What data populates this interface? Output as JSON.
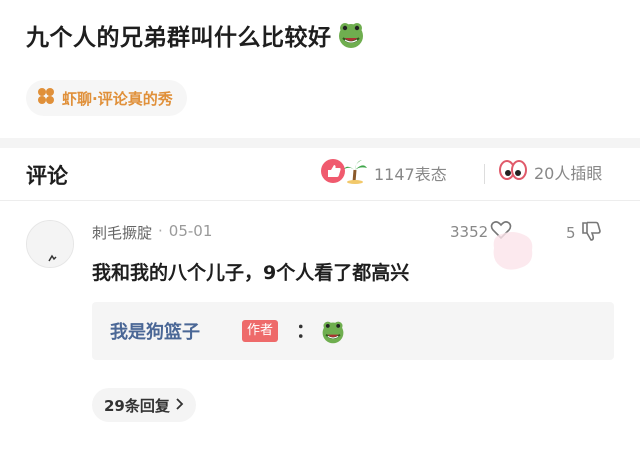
{
  "post": {
    "title": "九个人的兄弟群叫什么比较好",
    "title_emoji_icon": "green-frog-face-emoji",
    "topic_tag": "虾聊·评论真的秀",
    "topic_icon": "four-dots-flower-icon",
    "accent_color": "#e0903a"
  },
  "comments_header": {
    "title": "评论",
    "reactions_count": "1147表态",
    "eyes_count": "20人插眼"
  },
  "comment": {
    "username": "刺毛撅腚",
    "date": "05-01",
    "text": "我和我的八个儿子，9个人看了都高兴",
    "likes": "3352",
    "dislikes": "5"
  },
  "reply": {
    "author": "我是狗篮子",
    "badge": "作者",
    "colon": "：",
    "emoji_icon": "green-frog-face-emoji"
  },
  "more_replies": {
    "label": "29条回复"
  }
}
